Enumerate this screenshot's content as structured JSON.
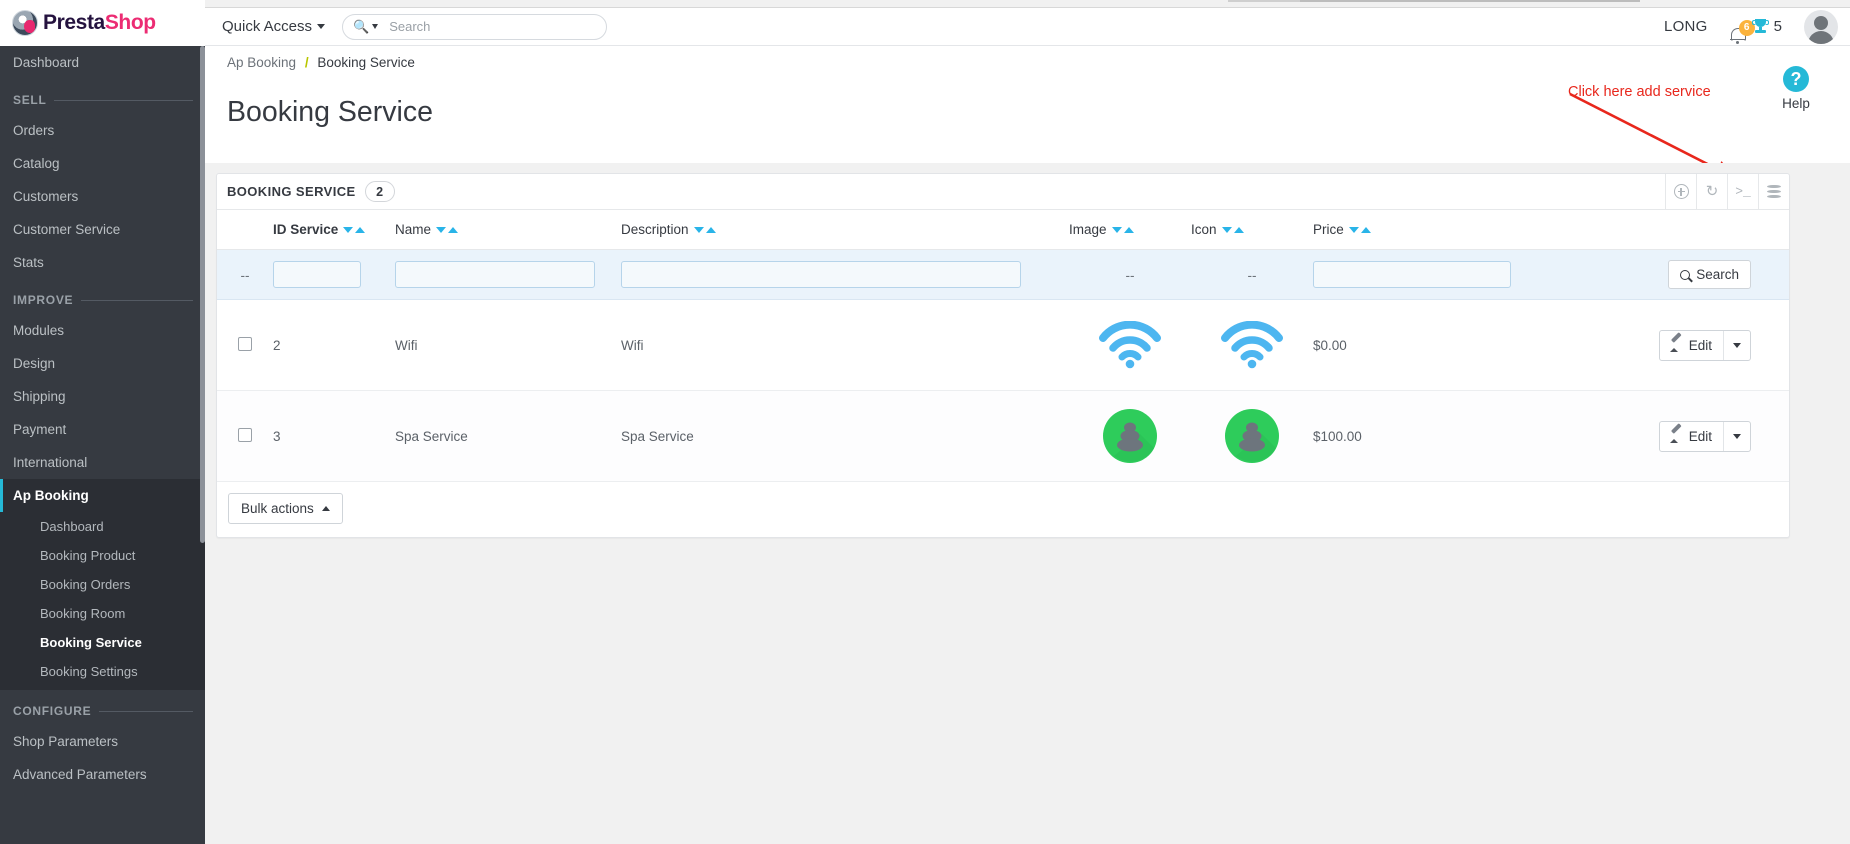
{
  "brand": {
    "part1": "Presta",
    "part2": "Shop"
  },
  "header": {
    "quick_access": "Quick Access",
    "search_placeholder": "Search",
    "search_value": "",
    "employee_name": "LONG",
    "notifications_count": "6",
    "trophy_count": "5",
    "icons": {
      "search": "search-icon",
      "bell": "bell-icon",
      "trophy": "trophy-icon",
      "avatar": "avatar-icon"
    }
  },
  "sidebar": {
    "top_items": [
      {
        "label": "Dashboard"
      }
    ],
    "sections": [
      {
        "title": "SELL",
        "items": [
          {
            "label": "Orders"
          },
          {
            "label": "Catalog"
          },
          {
            "label": "Customers"
          },
          {
            "label": "Customer Service"
          },
          {
            "label": "Stats"
          }
        ]
      },
      {
        "title": "IMPROVE",
        "items": [
          {
            "label": "Modules"
          },
          {
            "label": "Design"
          },
          {
            "label": "Shipping"
          },
          {
            "label": "Payment"
          },
          {
            "label": "International"
          }
        ]
      }
    ],
    "active_parent": "Ap Booking",
    "submenu": [
      {
        "label": "Dashboard",
        "active": false
      },
      {
        "label": "Booking Product",
        "active": false
      },
      {
        "label": "Booking Orders",
        "active": false
      },
      {
        "label": "Booking Room",
        "active": false
      },
      {
        "label": "Booking Service",
        "active": true
      },
      {
        "label": "Booking Settings",
        "active": false
      }
    ],
    "configure": {
      "title": "CONFIGURE",
      "items": [
        {
          "label": "Shop Parameters"
        },
        {
          "label": "Advanced Parameters"
        }
      ]
    }
  },
  "page": {
    "breadcrumb_parent": "Ap Booking",
    "breadcrumb_separator": "/",
    "breadcrumb_current": "Booking Service",
    "title": "Booking Service",
    "help_label": "Help",
    "help_glyph": "?"
  },
  "annotation": {
    "text": "Click here add service",
    "color": "#e8271c"
  },
  "panel": {
    "title": "BOOKING SERVICE",
    "count": "2",
    "tools": [
      {
        "name": "add-new-icon",
        "glyph": "plus"
      },
      {
        "name": "refresh-icon",
        "glyph": "refresh"
      },
      {
        "name": "console-icon",
        "glyph": "terminal"
      },
      {
        "name": "sql-manager-icon",
        "glyph": "database"
      }
    ]
  },
  "table": {
    "columns": [
      {
        "key": "id",
        "label": "ID Service",
        "sortable": true,
        "bold": true
      },
      {
        "key": "name",
        "label": "Name",
        "sortable": true,
        "bold": false
      },
      {
        "key": "description",
        "label": "Description",
        "sortable": true,
        "bold": false
      },
      {
        "key": "image",
        "label": "Image",
        "sortable": true,
        "bold": false
      },
      {
        "key": "icon",
        "label": "Icon",
        "sortable": true,
        "bold": false
      },
      {
        "key": "price",
        "label": "Price",
        "sortable": true,
        "bold": false
      }
    ],
    "filters": {
      "id": {
        "type": "text",
        "value": "",
        "placeholder": ""
      },
      "name": {
        "type": "text",
        "value": "",
        "placeholder": ""
      },
      "description": {
        "type": "text",
        "value": "",
        "placeholder": ""
      },
      "image": {
        "type": "none",
        "value": "--"
      },
      "icon": {
        "type": "none",
        "value": "--"
      },
      "price": {
        "type": "text",
        "value": "",
        "placeholder": ""
      },
      "checkbox_cell": "--",
      "search_button": "Search"
    },
    "rows": [
      {
        "selected": false,
        "id": "2",
        "name": "Wifi",
        "description": "Wifi",
        "image": "wifi-icon",
        "icon": "wifi-icon",
        "price": "$0.00",
        "action": "Edit"
      },
      {
        "selected": false,
        "id": "3",
        "name": "Spa Service",
        "description": "Spa Service",
        "image": "spa-stones-icon",
        "icon": "spa-stones-icon",
        "price": "$100.00",
        "action": "Edit"
      }
    ],
    "footer": {
      "bulk_actions": "Bulk actions"
    }
  },
  "colors": {
    "sidebar_bg": "#363a41",
    "accent": "#25b9d7",
    "sort_arrow": "#29b4e8",
    "wifi": "#4db6f0",
    "spa_circle": "#2ecc5b",
    "badge": "#fbb33d",
    "annotation": "#e8271c"
  }
}
